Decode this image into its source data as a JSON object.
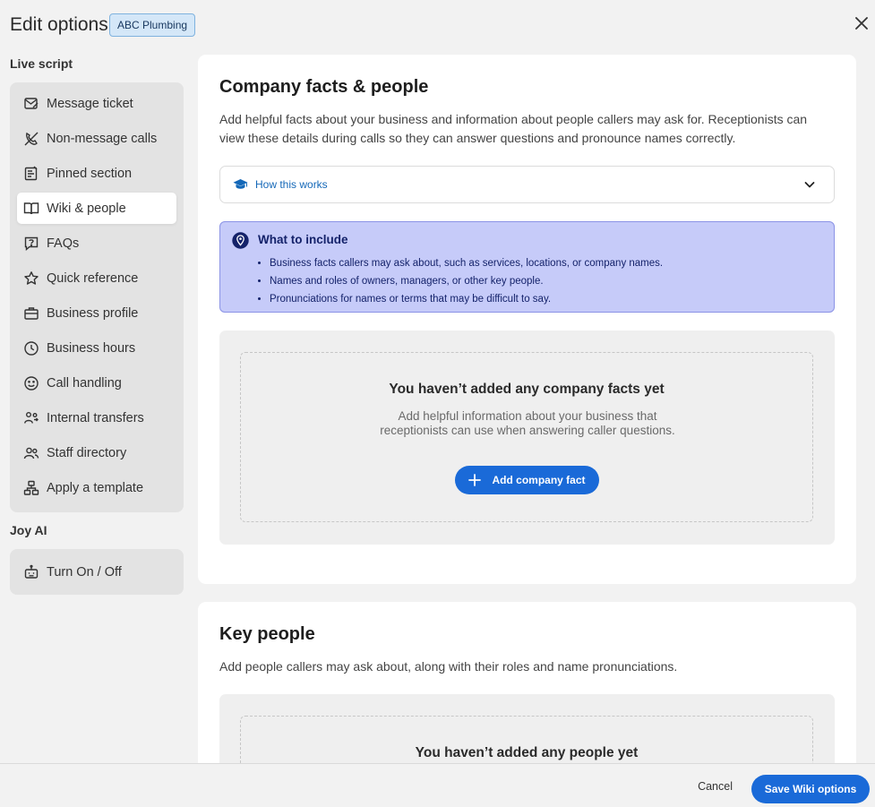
{
  "header": {
    "title": "Edit options",
    "badge": "ABC Plumbing"
  },
  "sidebar": {
    "live_script_heading": "Live script",
    "items": [
      {
        "label": "Message ticket",
        "icon": "message-ticket-icon"
      },
      {
        "label": "Non-message calls",
        "icon": "non-message-calls-icon"
      },
      {
        "label": "Pinned section",
        "icon": "pinned-section-icon"
      },
      {
        "label": "Wiki & people",
        "icon": "wiki-book-icon",
        "active": true
      },
      {
        "label": "FAQs",
        "icon": "faq-icon"
      },
      {
        "label": "Quick reference",
        "icon": "star-icon"
      },
      {
        "label": "Business profile",
        "icon": "briefcase-icon"
      },
      {
        "label": "Business hours",
        "icon": "clock-icon"
      },
      {
        "label": "Call handling",
        "icon": "smiley-icon"
      },
      {
        "label": "Internal transfers",
        "icon": "transfer-icon"
      },
      {
        "label": "Staff directory",
        "icon": "staff-icon"
      },
      {
        "label": "Apply a template",
        "icon": "template-icon"
      }
    ],
    "joy_heading": "Joy AI",
    "joy_items": [
      {
        "label": "Turn On / Off",
        "icon": "robot-icon"
      }
    ]
  },
  "company": {
    "title": "Company facts & people",
    "description": "Add helpful facts about your business and information about people callers may ask for. Receptionists can view these details during calls so they can answer questions and pronounce names correctly.",
    "how_works_label": "How this works",
    "include": {
      "title": "What to include",
      "items": [
        "Business facts callers may ask about, such as services, locations, or company names.",
        "Names and roles of owners, managers, or other key people.",
        "Pronunciations for names or terms that may be difficult to say."
      ]
    },
    "empty_title": "You haven’t added any company facts yet",
    "empty_subtitle": "Add helpful information about your business that receptionists can use when answering caller questions.",
    "add_button": "Add company fact"
  },
  "people": {
    "title": "Key people",
    "description": "Add people callers may ask about, along with their roles and name pronunciations.",
    "empty_title": "You haven’t added any people yet"
  },
  "footer": {
    "cancel_label": "Cancel",
    "save_label": "Save Wiki options"
  },
  "colors": {
    "accent": "#1a6ad8",
    "include_bg": "#c6cbf9",
    "badge_bg": "#d4e7f8"
  }
}
